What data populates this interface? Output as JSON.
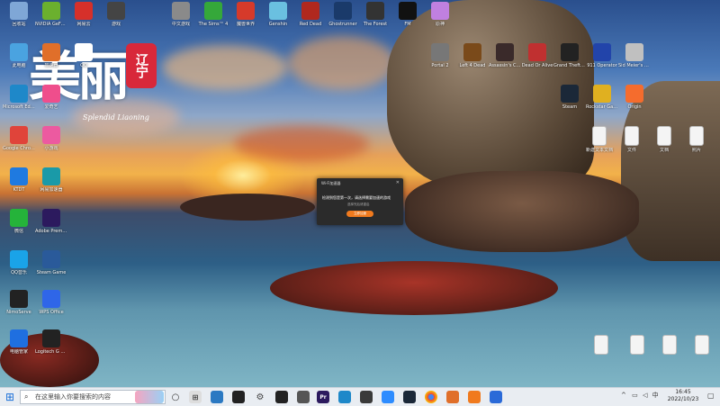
{
  "wallpaper": {
    "logo_main": "美丽",
    "logo_seal": "辽宁",
    "logo_sub": "Splendid Liaoning"
  },
  "desktop_icons": [
    {
      "label": "回收站",
      "icon": "recycle-bin-icon",
      "color": "#7fa7d6"
    },
    {
      "label": "此电脑",
      "icon": "computer-icon",
      "color": "#4aa3e0"
    },
    {
      "label": "Microsoft Edge",
      "icon": "edge-icon",
      "color": "#1e88c9"
    },
    {
      "label": "Google Chrome",
      "icon": "chrome-icon",
      "color": "#e0443a"
    },
    {
      "label": "KTDT",
      "icon": "ktdt-icon",
      "color": "#1f7ae0"
    },
    {
      "label": "微信",
      "icon": "wechat-icon",
      "color": "#25b33a"
    },
    {
      "label": "QQ音乐",
      "icon": "qqmusic-icon",
      "color": "#1aa3e8"
    },
    {
      "label": "NimoServe",
      "icon": "nimo-icon",
      "color": "#222222"
    },
    {
      "label": "电脑管家",
      "icon": "pcmanager-icon",
      "color": "#1f6fe0"
    },
    {
      "label": "NVIDIA GeForce",
      "icon": "nvidia-icon",
      "color": "#6bb02e"
    },
    {
      "label": "网易云",
      "icon": "netease-icon",
      "color": "#d6302a"
    },
    {
      "label": "加速器",
      "icon": "booster-icon",
      "color": "#e06f2a"
    },
    {
      "label": "爱奇艺",
      "icon": "iqiyi-icon",
      "color": "#ef4e8c"
    },
    {
      "label": "小游戏",
      "icon": "minigame-icon",
      "color": "#ec5aa0"
    },
    {
      "label": "Adobe Premiere P...",
      "icon": "premiere-icon",
      "color": "#2c1a5e"
    },
    {
      "label": "Steam Game",
      "icon": "game-icon",
      "color": "#2a5a9a"
    },
    {
      "label": "WPS Office",
      "icon": "wps-icon",
      "color": "#2f66e8"
    },
    {
      "label": "Logitech G HUB",
      "icon": "ghub-icon",
      "color": "#222222"
    },
    {
      "label": "网易加速器",
      "icon": "uu-icon",
      "color": "#1a9aa8"
    },
    {
      "label": "QQ",
      "icon": "qq-icon",
      "color": "#ffffff"
    },
    {
      "label": "游戏",
      "icon": "game2-icon",
      "color": "#444444"
    },
    {
      "label": "中文游戏",
      "icon": "speedometer-icon",
      "color": "#8a8a8a"
    },
    {
      "label": "The Sims™ 4",
      "icon": "sims-icon",
      "color": "#35a83a"
    },
    {
      "label": "魔兽世界",
      "icon": "game3-icon",
      "color": "#d63a2a"
    },
    {
      "label": "Genshin",
      "icon": "genshin-icon",
      "color": "#6ac0e0"
    },
    {
      "label": "Red Dead",
      "icon": "rdr-icon",
      "color": "#b0281e"
    },
    {
      "label": "Ghostrunner",
      "icon": "ghostrunner-icon",
      "color": "#1a3a6a"
    },
    {
      "label": "The Forest",
      "icon": "forest-icon",
      "color": "#333333"
    },
    {
      "label": "FM",
      "icon": "fm-icon",
      "color": "#111111"
    },
    {
      "label": "原神",
      "icon": "anime-icon",
      "color": "#c080e0"
    },
    {
      "label": "Portal 2",
      "icon": "portal-icon",
      "color": "#777777"
    },
    {
      "label": "Left 4 Dead",
      "icon": "l4d-icon",
      "color": "#7a4a1a"
    },
    {
      "label": "Assassin's Creed",
      "icon": "ac-icon",
      "color": "#3a2a2a"
    },
    {
      "label": "Dead Or Alive",
      "icon": "doa-icon",
      "color": "#c03030"
    },
    {
      "label": "Grand Theft Auto IV",
      "icon": "gta-icon",
      "color": "#222222"
    },
    {
      "label": "911 Operator",
      "icon": "911-icon",
      "color": "#2244aa"
    },
    {
      "label": "Sid Meier's Civilization",
      "icon": "civ-icon",
      "color": "#c0c0c0"
    },
    {
      "label": "Steam",
      "icon": "steam-icon",
      "color": "#1b2838"
    },
    {
      "label": "Rockstar Games",
      "icon": "rockstar-icon",
      "color": "#e0b020"
    },
    {
      "label": "Origin",
      "icon": "origin-icon",
      "color": "#f56c2d"
    }
  ],
  "files": [
    {
      "label": "新建文本文档",
      "icon": "document-icon"
    },
    {
      "label": "文件",
      "icon": "document-icon"
    },
    {
      "label": "文档",
      "icon": "document-icon"
    },
    {
      "label": "照片",
      "icon": "document-icon"
    }
  ],
  "dialog": {
    "title": "Wi-Fi加速器",
    "message": "检测到您是第一次，请选择需要加速的游戏",
    "sub": "选择完后请重启",
    "button": "立即加速",
    "close": "✕"
  },
  "taskbar": {
    "start": "⊞",
    "search_placeholder": "在这里输入你要搜索的内容",
    "time": "16:45",
    "date": "2022/10/23",
    "lang": "中"
  }
}
